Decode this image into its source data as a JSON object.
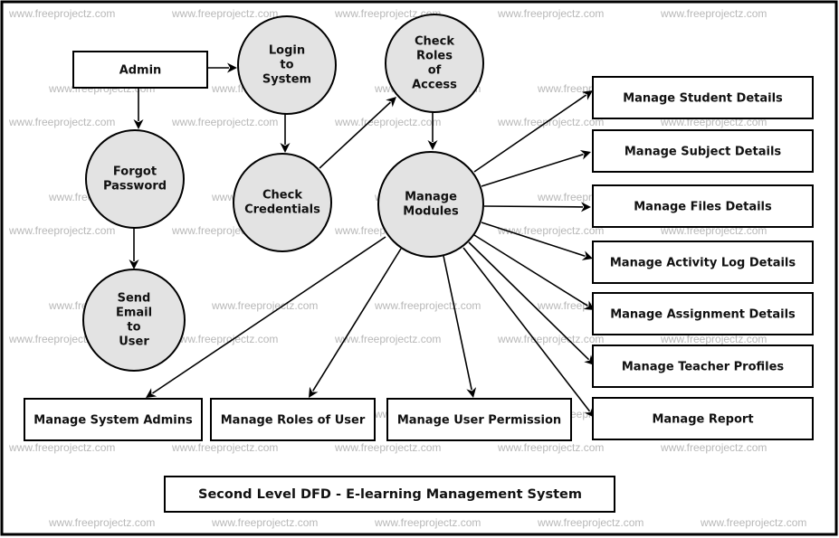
{
  "diagram": {
    "type": "Data Flow Diagram (Level 2)",
    "title": "Second Level DFD - E-learning Management System",
    "watermark": "www.freeprojectz.com",
    "colors": {
      "process_fill": "#e3e3e3",
      "stroke": "#000000",
      "background": "#ffffff",
      "watermark": "#b8b8b8"
    },
    "entities": [
      {
        "id": "admin",
        "label": "Admin"
      }
    ],
    "processes": [
      {
        "id": "login",
        "label": [
          "Login",
          "to",
          "System"
        ]
      },
      {
        "id": "check_roles",
        "label": [
          "Check",
          "Roles",
          "of",
          "Access"
        ]
      },
      {
        "id": "forgot",
        "label": [
          "Forgot",
          "Password"
        ]
      },
      {
        "id": "check_cred",
        "label": [
          "Check",
          "Credentials"
        ]
      },
      {
        "id": "manage_modules",
        "label": [
          "Manage",
          "Modules"
        ]
      },
      {
        "id": "send_email",
        "label": [
          "Send",
          "Email",
          "to",
          "User"
        ]
      }
    ],
    "stores": [
      {
        "id": "student",
        "label": "Manage Student Details"
      },
      {
        "id": "subject",
        "label": "Manage Subject Details"
      },
      {
        "id": "files",
        "label": "Manage Files Details"
      },
      {
        "id": "activity",
        "label": "Manage Activity Log Details"
      },
      {
        "id": "assignment",
        "label": "Manage Assignment Details"
      },
      {
        "id": "teacher",
        "label": "Manage Teacher Profiles"
      },
      {
        "id": "report",
        "label": "Manage Report"
      },
      {
        "id": "sysadmins",
        "label": "Manage System Admins"
      },
      {
        "id": "roles",
        "label": "Manage Roles of User"
      },
      {
        "id": "permission",
        "label": "Manage User Permission"
      }
    ],
    "flows": [
      {
        "from": "admin",
        "to": "login"
      },
      {
        "from": "admin",
        "to": "forgot"
      },
      {
        "from": "login",
        "to": "check_cred"
      },
      {
        "from": "check_cred",
        "to": "check_roles"
      },
      {
        "from": "check_roles",
        "to": "manage_modules"
      },
      {
        "from": "forgot",
        "to": "send_email"
      },
      {
        "from": "manage_modules",
        "to": "student"
      },
      {
        "from": "manage_modules",
        "to": "subject"
      },
      {
        "from": "manage_modules",
        "to": "files"
      },
      {
        "from": "manage_modules",
        "to": "activity"
      },
      {
        "from": "manage_modules",
        "to": "assignment"
      },
      {
        "from": "manage_modules",
        "to": "teacher"
      },
      {
        "from": "manage_modules",
        "to": "report"
      },
      {
        "from": "manage_modules",
        "to": "sysadmins"
      },
      {
        "from": "manage_modules",
        "to": "roles"
      },
      {
        "from": "manage_modules",
        "to": "permission"
      }
    ]
  }
}
